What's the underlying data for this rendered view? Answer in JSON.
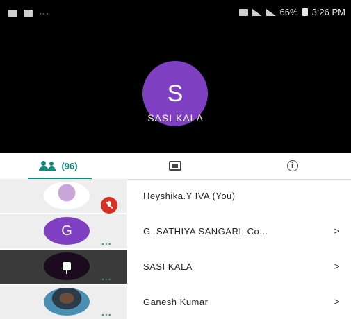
{
  "status_bar": {
    "battery": "66%",
    "time": "3:26 PM",
    "left_text": "···"
  },
  "speaker": {
    "initial": "S",
    "name": "SASI KALA",
    "avatar_color": "#7e3fc2"
  },
  "tabs": {
    "people_count": "(96)",
    "info_glyph": "i",
    "accent_color": "#0f8a7a"
  },
  "participants": [
    {
      "name": "Heyshika.Y IVA (You)",
      "avatar": "photo",
      "muted": true
    },
    {
      "name": "G. SATHIYA SANGARI, Co...",
      "avatar": "letter",
      "initial": "G",
      "more": "...",
      "chevron": ">"
    },
    {
      "name": "SASI KALA",
      "avatar": "pin",
      "more": "...",
      "chevron": ">",
      "active": true
    },
    {
      "name": "Ganesh Kumar",
      "avatar": "photo",
      "more": "...",
      "chevron": ">"
    }
  ]
}
